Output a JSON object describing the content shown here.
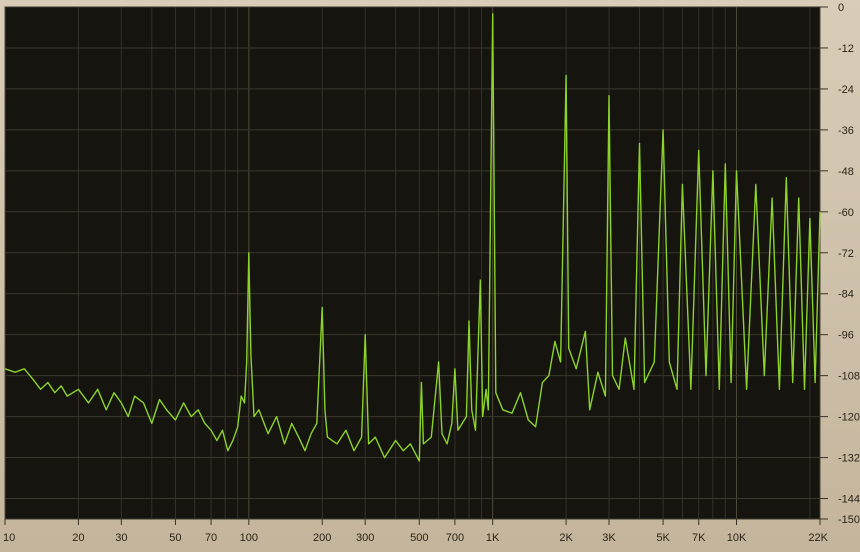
{
  "chart_data": {
    "type": "line",
    "title": "",
    "xlabel": "",
    "ylabel": "",
    "x_scale": "log",
    "xlim": [
      10,
      22000
    ],
    "ylim": [
      -150,
      0
    ],
    "grid": true,
    "x_ticks": [
      {
        "value": 10,
        "label": "10"
      },
      {
        "value": 20,
        "label": "20"
      },
      {
        "value": 30,
        "label": "30"
      },
      {
        "value": 50,
        "label": "50"
      },
      {
        "value": 70,
        "label": "70"
      },
      {
        "value": 100,
        "label": "100"
      },
      {
        "value": 200,
        "label": "200"
      },
      {
        "value": 300,
        "label": "300"
      },
      {
        "value": 500,
        "label": "500"
      },
      {
        "value": 700,
        "label": "700"
      },
      {
        "value": 1000,
        "label": "1K"
      },
      {
        "value": 2000,
        "label": "2K"
      },
      {
        "value": 3000,
        "label": "3K"
      },
      {
        "value": 5000,
        "label": "5K"
      },
      {
        "value": 7000,
        "label": "7K"
      },
      {
        "value": 10000,
        "label": "10K"
      },
      {
        "value": 22000,
        "label": "22K"
      }
    ],
    "y_ticks": [
      {
        "value": 0,
        "label": "0"
      },
      {
        "value": -12,
        "label": "-12"
      },
      {
        "value": -24,
        "label": "-24"
      },
      {
        "value": -36,
        "label": "-36"
      },
      {
        "value": -48,
        "label": "-48"
      },
      {
        "value": -60,
        "label": "-60"
      },
      {
        "value": -72,
        "label": "-72"
      },
      {
        "value": -84,
        "label": "-84"
      },
      {
        "value": -96,
        "label": "-96"
      },
      {
        "value": -108,
        "label": "-108"
      },
      {
        "value": -120,
        "label": "-120"
      },
      {
        "value": -132,
        "label": "-132"
      },
      {
        "value": -144,
        "label": "-144"
      },
      {
        "value": -150,
        "label": "-150"
      }
    ],
    "series": [
      {
        "color": "#8cd22a",
        "points": [
          [
            10,
            -106
          ],
          [
            11,
            -107
          ],
          [
            12,
            -106
          ],
          [
            13,
            -109
          ],
          [
            14,
            -112
          ],
          [
            15,
            -110
          ],
          [
            16,
            -113
          ],
          [
            17,
            -111
          ],
          [
            18,
            -114
          ],
          [
            20,
            -112
          ],
          [
            22,
            -116
          ],
          [
            24,
            -112
          ],
          [
            26,
            -118
          ],
          [
            28,
            -113
          ],
          [
            30,
            -116
          ],
          [
            32,
            -120
          ],
          [
            34,
            -114
          ],
          [
            37,
            -116
          ],
          [
            40,
            -122
          ],
          [
            43,
            -115
          ],
          [
            46,
            -118
          ],
          [
            50,
            -121
          ],
          [
            54,
            -116
          ],
          [
            58,
            -120
          ],
          [
            62,
            -118
          ],
          [
            66,
            -122
          ],
          [
            70,
            -124
          ],
          [
            74,
            -127
          ],
          [
            78,
            -124
          ],
          [
            82,
            -130
          ],
          [
            86,
            -127
          ],
          [
            90,
            -123
          ],
          [
            93,
            -114
          ],
          [
            96,
            -116
          ],
          [
            98,
            -104
          ],
          [
            100,
            -72
          ],
          [
            102,
            -102
          ],
          [
            105,
            -120
          ],
          [
            110,
            -118
          ],
          [
            120,
            -125
          ],
          [
            130,
            -120
          ],
          [
            140,
            -128
          ],
          [
            150,
            -122
          ],
          [
            160,
            -126
          ],
          [
            170,
            -130
          ],
          [
            180,
            -125
          ],
          [
            190,
            -122
          ],
          [
            200,
            -88
          ],
          [
            205,
            -118
          ],
          [
            210,
            -126
          ],
          [
            230,
            -128
          ],
          [
            250,
            -124
          ],
          [
            270,
            -130
          ],
          [
            290,
            -126
          ],
          [
            300,
            -96
          ],
          [
            310,
            -128
          ],
          [
            330,
            -126
          ],
          [
            360,
            -132
          ],
          [
            400,
            -127
          ],
          [
            430,
            -130
          ],
          [
            460,
            -128
          ],
          [
            500,
            -133
          ],
          [
            510,
            -110
          ],
          [
            520,
            -128
          ],
          [
            560,
            -126
          ],
          [
            600,
            -104
          ],
          [
            620,
            -125
          ],
          [
            650,
            -128
          ],
          [
            680,
            -122
          ],
          [
            700,
            -106
          ],
          [
            720,
            -124
          ],
          [
            780,
            -120
          ],
          [
            800,
            -92
          ],
          [
            820,
            -118
          ],
          [
            850,
            -124
          ],
          [
            890,
            -80
          ],
          [
            910,
            -120
          ],
          [
            940,
            -112
          ],
          [
            960,
            -118
          ],
          [
            1000,
            -2
          ],
          [
            1030,
            -113
          ],
          [
            1100,
            -118
          ],
          [
            1200,
            -119
          ],
          [
            1300,
            -113
          ],
          [
            1400,
            -121
          ],
          [
            1500,
            -123
          ],
          [
            1600,
            -110
          ],
          [
            1700,
            -108
          ],
          [
            1800,
            -98
          ],
          [
            1900,
            -104
          ],
          [
            2000,
            -20
          ],
          [
            2050,
            -100
          ],
          [
            2200,
            -106
          ],
          [
            2400,
            -95
          ],
          [
            2500,
            -118
          ],
          [
            2700,
            -107
          ],
          [
            2900,
            -114
          ],
          [
            3000,
            -26
          ],
          [
            3100,
            -108
          ],
          [
            3300,
            -112
          ],
          [
            3500,
            -97
          ],
          [
            3800,
            -112
          ],
          [
            4000,
            -40
          ],
          [
            4200,
            -110
          ],
          [
            4600,
            -104
          ],
          [
            5000,
            -36
          ],
          [
            5300,
            -104
          ],
          [
            5700,
            -112
          ],
          [
            6000,
            -52
          ],
          [
            6500,
            -112
          ],
          [
            7000,
            -42
          ],
          [
            7500,
            -108
          ],
          [
            8000,
            -48
          ],
          [
            8500,
            -112
          ],
          [
            9000,
            -46
          ],
          [
            9500,
            -110
          ],
          [
            10000,
            -48
          ],
          [
            11000,
            -112
          ],
          [
            12000,
            -52
          ],
          [
            13000,
            -108
          ],
          [
            14000,
            -56
          ],
          [
            15000,
            -112
          ],
          [
            16000,
            -50
          ],
          [
            17000,
            -110
          ],
          [
            18000,
            -56
          ],
          [
            19000,
            -112
          ],
          [
            20000,
            -62
          ],
          [
            21000,
            -110
          ],
          [
            22000,
            -60
          ]
        ]
      }
    ]
  }
}
